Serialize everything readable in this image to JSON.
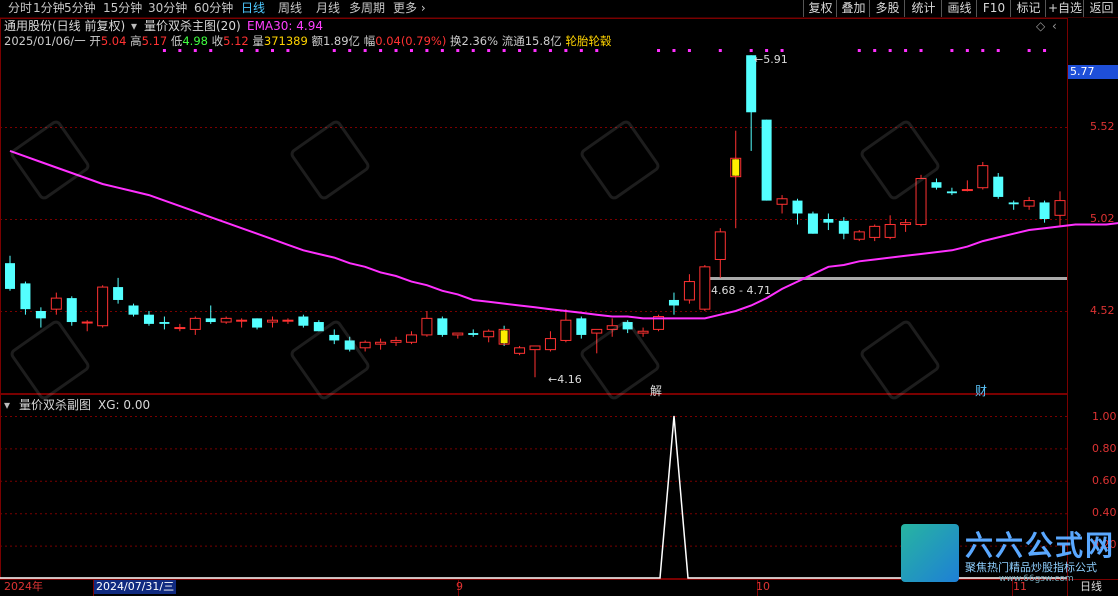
{
  "toolbar": {
    "left": [
      "分时",
      "1分钟",
      "5分钟",
      "15分钟",
      "30分钟",
      "60分钟",
      "日线",
      "周线",
      "月线",
      "多周期",
      "更多 ›"
    ],
    "active": "日线",
    "right": [
      "复权",
      "叠加",
      "多股",
      "统计",
      "画线",
      "F10",
      "标记",
      "+自选",
      "返回"
    ]
  },
  "header": {
    "stock": "通用股份(日线 前复权)",
    "indicator": "量价双杀主图(20)",
    "ema": "EMA30: 4.94",
    "date": "2025/01/06/一",
    "open_l": "开",
    "open": "5.04",
    "high_l": "高",
    "high": "5.17",
    "low_l": "低",
    "low": "4.98",
    "close_l": "收",
    "close": "5.12",
    "vol_l": "量",
    "vol": "371389",
    "amt_l": "额",
    "amt": "1.89亿",
    "chg_l": "幅",
    "chg": "0.04(0.79%)",
    "turn_l": "换",
    "turn": "2.36%",
    "float_l": "流通",
    "float": "15.8亿",
    "concept": "轮胎轮毂"
  },
  "price_axis": {
    "current": "5.77",
    "ticks": [
      "5.52",
      "5.02",
      "4.52"
    ]
  },
  "annotations": {
    "high": "5.91",
    "low": "4.16",
    "range": "4.68 - 4.71",
    "mark1": "解",
    "mark2": "财"
  },
  "sub": {
    "title": "量价双杀副图",
    "xg": "XG: 0.00",
    "ticks": [
      "1.00",
      "0.80",
      "0.60",
      "0.40",
      "0.20"
    ]
  },
  "xaxis": {
    "labels": [
      "2024年",
      "2024/07/31/三",
      "9",
      "10",
      "11"
    ],
    "period": "日线"
  },
  "watermark": {
    "brand": "六六公式网",
    "slogan": "聚焦热门精品炒股指标公式",
    "url": "www.66gsw.com"
  },
  "colors": {
    "up": "#ff3232",
    "down": "#54ffff",
    "ema": "#ff30ff",
    "grid": "#7a0000"
  },
  "chart_data": {
    "type": "candlestick",
    "ema_label": "EMA30",
    "candles": [
      {
        "o": 4.78,
        "h": 4.82,
        "l": 4.63,
        "c": 4.64
      },
      {
        "o": 4.67,
        "h": 4.68,
        "l": 4.5,
        "c": 4.53
      },
      {
        "o": 4.52,
        "h": 4.54,
        "l": 4.43,
        "c": 4.48
      },
      {
        "o": 4.53,
        "h": 4.62,
        "l": 4.5,
        "c": 4.59
      },
      {
        "o": 4.59,
        "h": 4.6,
        "l": 4.44,
        "c": 4.46
      },
      {
        "o": 4.46,
        "h": 4.47,
        "l": 4.41,
        "c": 4.46
      },
      {
        "o": 4.44,
        "h": 4.66,
        "l": 4.43,
        "c": 4.65
      },
      {
        "o": 4.65,
        "h": 4.7,
        "l": 4.56,
        "c": 4.58
      },
      {
        "o": 4.55,
        "h": 4.56,
        "l": 4.49,
        "c": 4.5
      },
      {
        "o": 4.5,
        "h": 4.52,
        "l": 4.44,
        "c": 4.45
      },
      {
        "o": 4.46,
        "h": 4.49,
        "l": 4.42,
        "c": 4.45
      },
      {
        "o": 4.43,
        "h": 4.45,
        "l": 4.41,
        "c": 4.43
      },
      {
        "o": 4.42,
        "h": 4.49,
        "l": 4.39,
        "c": 4.48
      },
      {
        "o": 4.48,
        "h": 4.55,
        "l": 4.45,
        "c": 4.46
      },
      {
        "o": 4.46,
        "h": 4.49,
        "l": 4.45,
        "c": 4.48
      },
      {
        "o": 4.47,
        "h": 4.48,
        "l": 4.43,
        "c": 4.47
      },
      {
        "o": 4.48,
        "h": 4.48,
        "l": 4.42,
        "c": 4.43
      },
      {
        "o": 4.46,
        "h": 4.49,
        "l": 4.43,
        "c": 4.47
      },
      {
        "o": 4.47,
        "h": 4.48,
        "l": 4.45,
        "c": 4.47
      },
      {
        "o": 4.49,
        "h": 4.5,
        "l": 4.43,
        "c": 4.44
      },
      {
        "o": 4.46,
        "h": 4.47,
        "l": 4.41,
        "c": 4.41
      },
      {
        "o": 4.39,
        "h": 4.42,
        "l": 4.34,
        "c": 4.36
      },
      {
        "o": 4.36,
        "h": 4.38,
        "l": 4.3,
        "c": 4.31
      },
      {
        "o": 4.32,
        "h": 4.36,
        "l": 4.3,
        "c": 4.35
      },
      {
        "o": 4.34,
        "h": 4.37,
        "l": 4.31,
        "c": 4.35
      },
      {
        "o": 4.35,
        "h": 4.38,
        "l": 4.33,
        "c": 4.36
      },
      {
        "o": 4.35,
        "h": 4.41,
        "l": 4.34,
        "c": 4.39
      },
      {
        "o": 4.39,
        "h": 4.52,
        "l": 4.38,
        "c": 4.48
      },
      {
        "o": 4.48,
        "h": 4.49,
        "l": 4.38,
        "c": 4.39
      },
      {
        "o": 4.39,
        "h": 4.4,
        "l": 4.37,
        "c": 4.4
      },
      {
        "o": 4.4,
        "h": 4.42,
        "l": 4.38,
        "c": 4.39
      },
      {
        "o": 4.38,
        "h": 4.42,
        "l": 4.35,
        "c": 4.41
      },
      {
        "o": 4.42,
        "h": 4.44,
        "l": 4.33,
        "c": 4.34
      },
      {
        "o": 4.29,
        "h": 4.33,
        "l": 4.28,
        "c": 4.32
      },
      {
        "o": 4.31,
        "h": 4.33,
        "l": 4.16,
        "c": 4.33
      },
      {
        "o": 4.31,
        "h": 4.41,
        "l": 4.3,
        "c": 4.37
      },
      {
        "o": 4.36,
        "h": 4.53,
        "l": 4.35,
        "c": 4.47
      },
      {
        "o": 4.48,
        "h": 4.49,
        "l": 4.37,
        "c": 4.39
      },
      {
        "o": 4.4,
        "h": 4.42,
        "l": 4.29,
        "c": 4.42
      },
      {
        "o": 4.42,
        "h": 4.48,
        "l": 4.38,
        "c": 4.44
      },
      {
        "o": 4.46,
        "h": 4.47,
        "l": 4.4,
        "c": 4.42
      },
      {
        "o": 4.4,
        "h": 4.43,
        "l": 4.38,
        "c": 4.41
      },
      {
        "o": 4.42,
        "h": 4.5,
        "l": 4.41,
        "c": 4.49
      },
      {
        "o": 4.58,
        "h": 4.62,
        "l": 4.5,
        "c": 4.55
      },
      {
        "o": 4.58,
        "h": 4.72,
        "l": 4.56,
        "c": 4.68
      },
      {
        "o": 4.53,
        "h": 4.77,
        "l": 4.52,
        "c": 4.76
      },
      {
        "o": 4.8,
        "h": 4.97,
        "l": 4.7,
        "c": 4.95
      },
      {
        "o": 5.25,
        "h": 5.5,
        "l": 4.97,
        "c": 5.35
      },
      {
        "o": 5.91,
        "h": 5.91,
        "l": 5.39,
        "c": 5.6
      },
      {
        "o": 5.56,
        "h": 5.56,
        "l": 5.12,
        "c": 5.12
      },
      {
        "o": 5.1,
        "h": 5.15,
        "l": 5.05,
        "c": 5.13
      },
      {
        "o": 5.12,
        "h": 5.13,
        "l": 4.99,
        "c": 5.05
      },
      {
        "o": 5.05,
        "h": 5.06,
        "l": 4.94,
        "c": 4.94
      },
      {
        "o": 5.02,
        "h": 5.05,
        "l": 4.96,
        "c": 5.0
      },
      {
        "o": 5.01,
        "h": 5.03,
        "l": 4.91,
        "c": 4.94
      },
      {
        "o": 4.91,
        "h": 4.96,
        "l": 4.9,
        "c": 4.95
      },
      {
        "o": 4.92,
        "h": 4.99,
        "l": 4.9,
        "c": 4.98
      },
      {
        "o": 4.92,
        "h": 5.04,
        "l": 4.91,
        "c": 4.99
      },
      {
        "o": 4.99,
        "h": 5.02,
        "l": 4.95,
        "c": 5.0
      },
      {
        "o": 4.99,
        "h": 5.26,
        "l": 4.98,
        "c": 5.24
      },
      {
        "o": 5.22,
        "h": 5.24,
        "l": 5.18,
        "c": 5.19
      },
      {
        "o": 5.17,
        "h": 5.19,
        "l": 5.15,
        "c": 5.16
      },
      {
        "o": 5.18,
        "h": 5.23,
        "l": 5.17,
        "c": 5.18
      },
      {
        "o": 5.19,
        "h": 5.33,
        "l": 5.18,
        "c": 5.31
      },
      {
        "o": 5.25,
        "h": 5.27,
        "l": 5.13,
        "c": 5.14
      },
      {
        "o": 5.11,
        "h": 5.12,
        "l": 5.07,
        "c": 5.1
      },
      {
        "o": 5.09,
        "h": 5.14,
        "l": 5.07,
        "c": 5.12
      },
      {
        "o": 5.11,
        "h": 5.12,
        "l": 5.0,
        "c": 5.02
      },
      {
        "o": 5.04,
        "h": 5.17,
        "l": 4.98,
        "c": 5.12
      }
    ],
    "highlight": [
      32,
      47
    ],
    "ema30": [
      5.39,
      5.36,
      5.33,
      5.3,
      5.27,
      5.24,
      5.21,
      5.19,
      5.17,
      5.15,
      5.12,
      5.09,
      5.06,
      5.03,
      5.0,
      4.97,
      4.94,
      4.91,
      4.88,
      4.85,
      4.83,
      4.81,
      4.78,
      4.76,
      4.73,
      4.71,
      4.68,
      4.66,
      4.63,
      4.61,
      4.58,
      4.57,
      4.56,
      4.55,
      4.54,
      4.53,
      4.52,
      4.51,
      4.5,
      4.49,
      4.49,
      4.48,
      4.48,
      4.48,
      4.48,
      4.48,
      4.5,
      4.52,
      4.55,
      4.59,
      4.64,
      4.68,
      4.72,
      4.76,
      4.77,
      4.79,
      4.8,
      4.81,
      4.82,
      4.83,
      4.84,
      4.85,
      4.87,
      4.9,
      4.92,
      4.94,
      4.96,
      4.97,
      4.98,
      4.99,
      4.99,
      4.99,
      5.0
    ],
    "sub_xg": {
      "peak_index": 43,
      "peak_value": 1.0
    },
    "price_range": [
      4.12,
      5.95
    ]
  }
}
